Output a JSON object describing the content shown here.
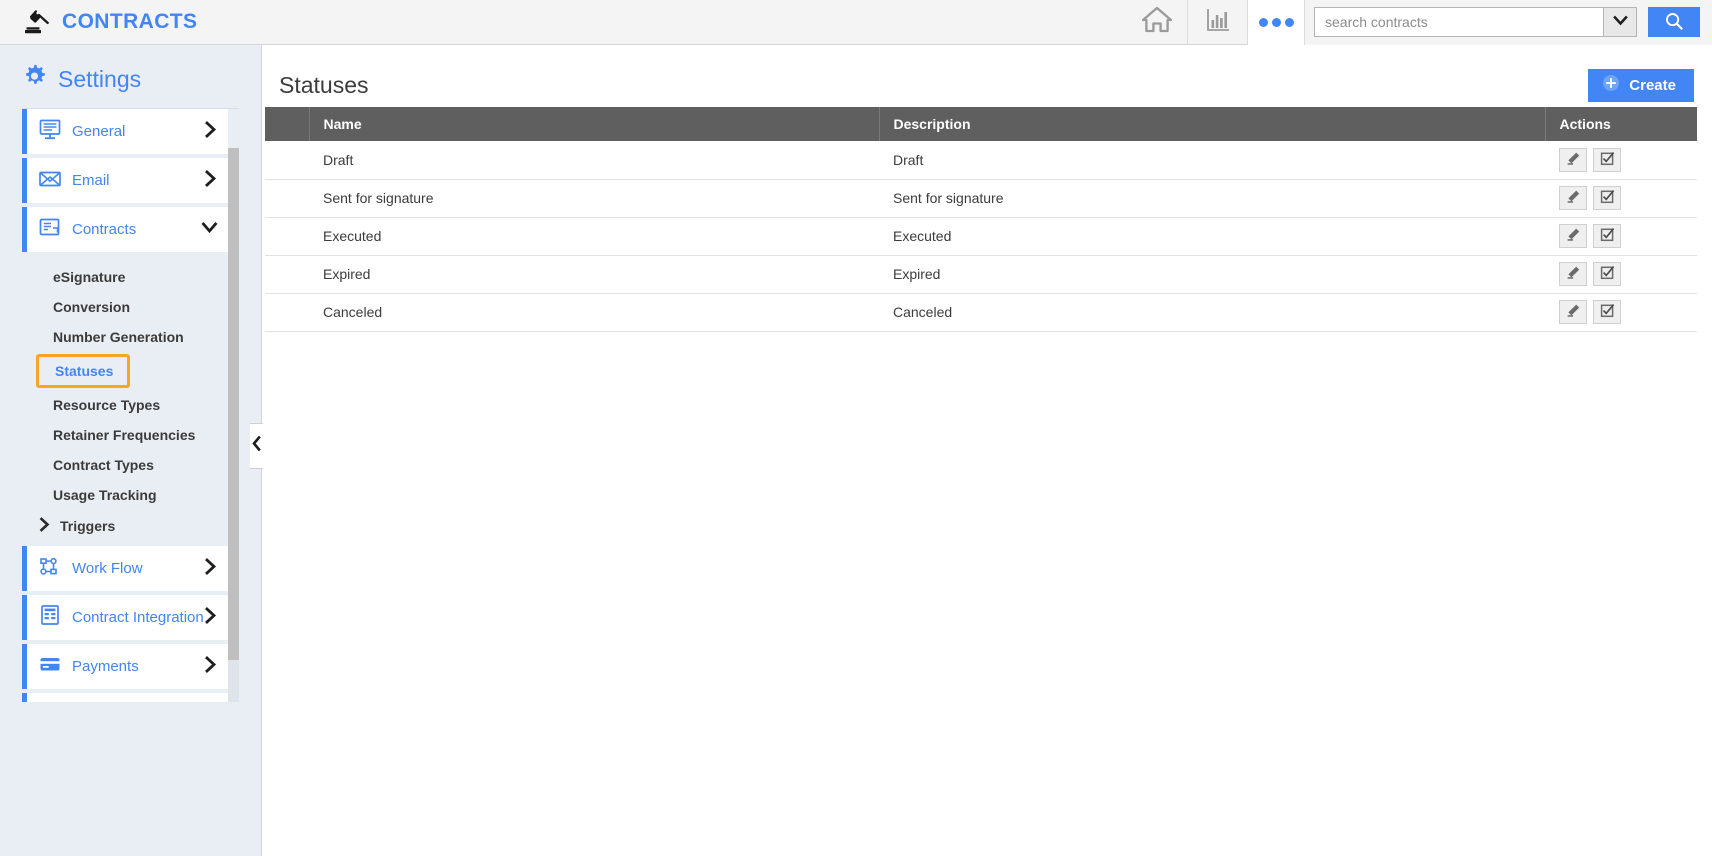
{
  "topbar": {
    "brand_title": "CONTRACTS",
    "brand_icon": "gavel-icon",
    "home_icon": "home-icon",
    "reports_icon": "bar-chart-icon",
    "more_icon": "more-dots-icon",
    "search": {
      "placeholder": "search contracts",
      "value": "",
      "dropdown_icon": "chevron-down-icon",
      "button_icon": "search-icon"
    },
    "accent_color": "#4285f4",
    "background_color": "#f4f4f4"
  },
  "sidebar": {
    "title": "Settings",
    "title_icon": "gear-icon",
    "background_color": "#e9eef4",
    "collapse_icon": "chevron-left-icon",
    "items": [
      {
        "label": "General",
        "icon": "monitor-icon",
        "chevron": "chevron-right-icon",
        "expanded": false
      },
      {
        "label": "Email",
        "icon": "envelope-icon",
        "chevron": "chevron-right-icon",
        "expanded": false
      },
      {
        "label": "Contracts",
        "icon": "contract-document-icon",
        "chevron": "chevron-down-icon",
        "expanded": true
      },
      {
        "label": "Work Flow",
        "icon": "workflow-nodes-icon",
        "chevron": "chevron-right-icon",
        "expanded": false
      },
      {
        "label": "Contract Integration",
        "icon": "integration-form-icon",
        "chevron": "chevron-right-icon",
        "expanded": false
      },
      {
        "label": "Payments",
        "icon": "credit-card-icon",
        "chevron": "chevron-right-icon",
        "expanded": false
      }
    ],
    "contracts_subitems": [
      {
        "label": "eSignature",
        "active": false,
        "expandable": false
      },
      {
        "label": "Conversion",
        "active": false,
        "expandable": false
      },
      {
        "label": "Number Generation",
        "active": false,
        "expandable": false
      },
      {
        "label": "Statuses",
        "active": true,
        "expandable": false
      },
      {
        "label": "Resource Types",
        "active": false,
        "expandable": false
      },
      {
        "label": "Retainer Frequencies",
        "active": false,
        "expandable": false
      },
      {
        "label": "Contract Types",
        "active": false,
        "expandable": false
      },
      {
        "label": "Usage Tracking",
        "active": false,
        "expandable": false
      },
      {
        "label": "Triggers",
        "active": false,
        "expandable": true,
        "chevron": "chevron-right-icon"
      }
    ],
    "active_highlight_color": "#f5a623"
  },
  "main": {
    "page_title": "Statuses",
    "create_button": {
      "label": "Create",
      "icon": "plus-circle-icon",
      "color": "#4285f4"
    },
    "table": {
      "header_background": "#5f5f5f",
      "columns": [
        "",
        "Name",
        "Description",
        "Actions"
      ],
      "row_actions": [
        {
          "name": "edit-button",
          "icon": "pencil-icon"
        },
        {
          "name": "select-button",
          "icon": "checkbox-checked-icon"
        }
      ],
      "rows": [
        {
          "name": "Draft",
          "description": "Draft"
        },
        {
          "name": "Sent for signature",
          "description": "Sent for signature"
        },
        {
          "name": "Executed",
          "description": "Executed"
        },
        {
          "name": "Expired",
          "description": "Expired"
        },
        {
          "name": "Canceled",
          "description": "Canceled"
        }
      ]
    }
  }
}
